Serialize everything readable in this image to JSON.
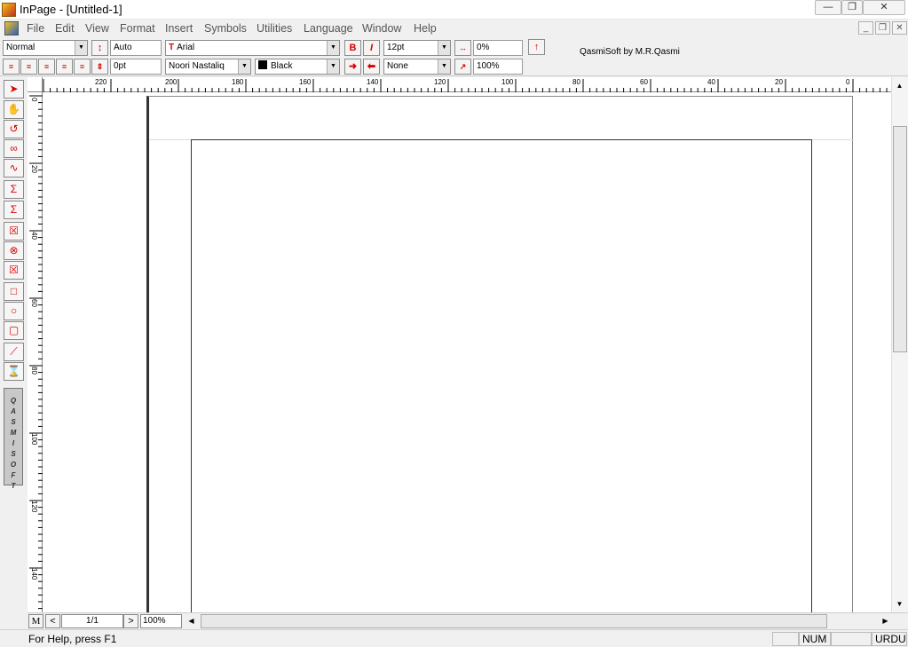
{
  "window": {
    "title": "InPage - [Untitled-1]"
  },
  "menu": {
    "items": [
      "File",
      "Edit",
      "View",
      "Format",
      "Insert",
      "Symbols",
      "Utilities",
      "Language",
      "Window",
      "Help"
    ]
  },
  "toolbar": {
    "style": "Normal",
    "leading": "Auto",
    "font_name": "Arial",
    "font_size": "12pt",
    "tracking": "0%",
    "indent": "0pt",
    "urdu_font": "Noori Nastaliq",
    "color": "Black",
    "color_hex": "#000000",
    "shade": "None",
    "scale": "100%",
    "credit": "QasmiSoft by M.R.Qasmi",
    "bold_label": "B",
    "italic_label": "I"
  },
  "ruler": {
    "h_labels": [
      "220",
      "200",
      "180",
      "160",
      "140",
      "120",
      "100",
      "80",
      "60",
      "40",
      "20",
      "0"
    ],
    "v_labels": [
      "0",
      "20",
      "40",
      "60",
      "80",
      "100",
      "120",
      "140"
    ]
  },
  "toolbox": {
    "brand": "QASMI SOFT"
  },
  "navigation": {
    "master": "M",
    "page": "1/1",
    "zoom": "100%"
  },
  "status": {
    "help": "For Help, press F1",
    "num": "NUM",
    "lang": "URDU"
  }
}
